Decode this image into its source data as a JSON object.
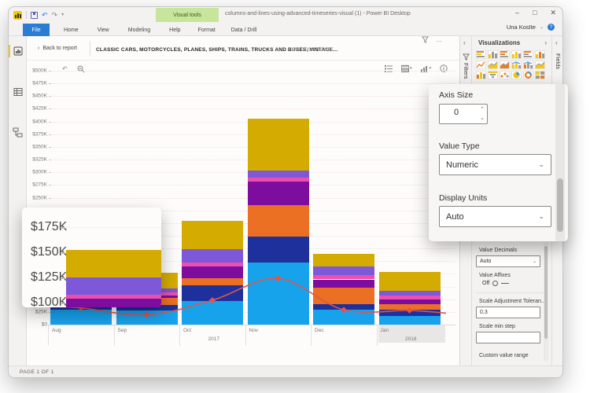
{
  "titlebar": {
    "visual_tools_label": "Visual tools",
    "window_title": "columns-and-lines-using-advanced-timeseries-visual (1) - Power BI Desktop",
    "qat_icons": [
      "powerbi-logo",
      "save",
      "undo",
      "redo",
      "customize-caret"
    ],
    "window_controls": [
      "minimize",
      "maximize",
      "close"
    ],
    "user_name": "Una Kosīte"
  },
  "ribbon": {
    "file_tab": "File",
    "tabs": [
      "Home",
      "View",
      "Modeling",
      "Help"
    ],
    "contextual_tabs": [
      "Format",
      "Data / Drill"
    ]
  },
  "sidebar_icons": [
    "report-view",
    "data-view",
    "model-view"
  ],
  "visual_header": {
    "back_label": "Back to report",
    "title": "CLASSIC CARS, MOTORCYCLES, PLANES, SHIPS, TRAINS, TRUCKS AND BUSES, VINTAGE...",
    "by_label": "BY ORDERDATE",
    "header_icons": [
      "filter-funnel",
      "more-options"
    ]
  },
  "chart_toolbar": {
    "left_icons": [
      "undo-arrow",
      "zoom-out-magnifier"
    ],
    "right_icons": [
      "legend-list",
      "calendar-dropdown",
      "chart-type-dropdown",
      "info-circle"
    ]
  },
  "chart_data": {
    "type": "bar",
    "subtype": "stacked-columns-with-line",
    "title": "CLASSIC CARS, MOTORCYCLES, PLANES, SHIPS, TRAINS, TRUCKS AND BUSES, VINTAGE... BY ORDERDATE",
    "categories": [
      "Aug",
      "Sep",
      "Oct",
      "Nov",
      "Dec",
      "Jan"
    ],
    "year_groups": [
      {
        "label": "2017",
        "span": [
          0,
          4
        ]
      },
      {
        "label": "2018",
        "span": [
          5,
          5
        ]
      }
    ],
    "y_axis": {
      "min": 0,
      "max": 500000,
      "tick_step": 25000,
      "tick_labels": [
        "$0",
        "$25K",
        "$50K",
        "$75K",
        "$100K",
        "$125K",
        "$150K",
        "$175K",
        "$200K",
        "$225K",
        "$250K",
        "$275K",
        "$300K",
        "$325K",
        "$350K",
        "$375K",
        "$400K",
        "$425K",
        "$450K",
        "$475K",
        "$500K"
      ]
    },
    "grid": true,
    "legend_position": "none",
    "series": [
      {
        "name": "Classic Cars",
        "color": "#17a2ec",
        "values": [
          30000,
          28000,
          46000,
          122000,
          29000,
          17000
        ]
      },
      {
        "name": "Motorcycles",
        "color": "#1d309c",
        "values": [
          14000,
          11000,
          31000,
          51000,
          12000,
          12000
        ]
      },
      {
        "name": "Planes",
        "color": "#ec7024",
        "values": [
          30000,
          14000,
          14000,
          62000,
          31000,
          12000
        ]
      },
      {
        "name": "Ships",
        "color": "#7d0d9e",
        "values": [
          30000,
          5000,
          23000,
          46000,
          17000,
          8000
        ]
      },
      {
        "name": "Trains",
        "color": "#ee4fae",
        "values": [
          4000,
          5000,
          9000,
          8000,
          8000,
          9000
        ]
      },
      {
        "name": "Trucks and Buses",
        "color": "#7d58d8",
        "values": [
          17000,
          8000,
          25000,
          15000,
          17000,
          8000
        ]
      },
      {
        "name": "Vintage Cars",
        "color": "#d4ab00",
        "values": [
          27000,
          31000,
          57000,
          101000,
          26000,
          37000
        ]
      }
    ],
    "stack_totals": [
      152000,
      102000,
      205000,
      405000,
      140000,
      103000
    ],
    "line_series": {
      "name": "",
      "color": "#e2544a",
      "marker": "diamond",
      "values": [
        33000,
        19000,
        48000,
        91000,
        29000,
        28000
      ]
    }
  },
  "axis_zoom_callout": {
    "labels": [
      "$175K",
      "$150K",
      "$125K",
      "$100K"
    ],
    "magnified_category": "Aug"
  },
  "format_zoom_callout": {
    "axis_size_label": "Axis Size",
    "axis_size_value": "0",
    "value_type_label": "Value Type",
    "value_type_value": "Numeric",
    "display_units_label": "Display Units",
    "display_units_value": "Auto"
  },
  "panes": {
    "filters_label": "Filters",
    "fields_label": "Fields",
    "visualizations": {
      "title": "Visualizations",
      "icons": [
        {
          "name": "stacked-bar-chart-icon",
          "type": "hbars"
        },
        {
          "name": "stacked-column-chart-icon",
          "type": "bars"
        },
        {
          "name": "clustered-bar-chart-icon",
          "type": "hbars"
        },
        {
          "name": "clustered-column-chart-icon",
          "type": "bars"
        },
        {
          "name": "100-stacked-bar-chart-icon",
          "type": "hbars"
        },
        {
          "name": "100-stacked-column-chart-icon",
          "type": "bars"
        },
        {
          "name": "line-chart-icon",
          "type": "line"
        },
        {
          "name": "area-chart-icon",
          "type": "area"
        },
        {
          "name": "stacked-area-chart-icon",
          "type": "area"
        },
        {
          "name": "line-clustered-column-chart-icon",
          "type": "combo"
        },
        {
          "name": "line-stacked-column-chart-icon",
          "type": "combo"
        },
        {
          "name": "ribbon-chart-icon",
          "type": "area"
        },
        {
          "name": "waterfall-chart-icon",
          "type": "bars"
        },
        {
          "name": "funnel-chart-icon",
          "type": "funnel"
        },
        {
          "name": "scatter-chart-icon",
          "type": "scatter"
        },
        {
          "name": "pie-chart-icon",
          "type": "pie"
        },
        {
          "name": "donut-chart-icon",
          "type": "donut"
        },
        {
          "name": "matrix-icon",
          "type": "grid"
        }
      ]
    },
    "format_pane": {
      "value_decimals_label": "Value Decimals",
      "value_decimals_value": "Auto",
      "value_affixes_label": "Value Affixes",
      "value_affixes_state": "Off",
      "scale_adjustment_label": "Scale Adjustment Toleran...",
      "scale_adjustment_value": "0.3",
      "scale_min_step_label": "Scale min step",
      "scale_min_step_value": "",
      "custom_value_range_label": "Custom value range"
    }
  },
  "statusbar": {
    "page_indicator": "PAGE 1 OF 1"
  }
}
